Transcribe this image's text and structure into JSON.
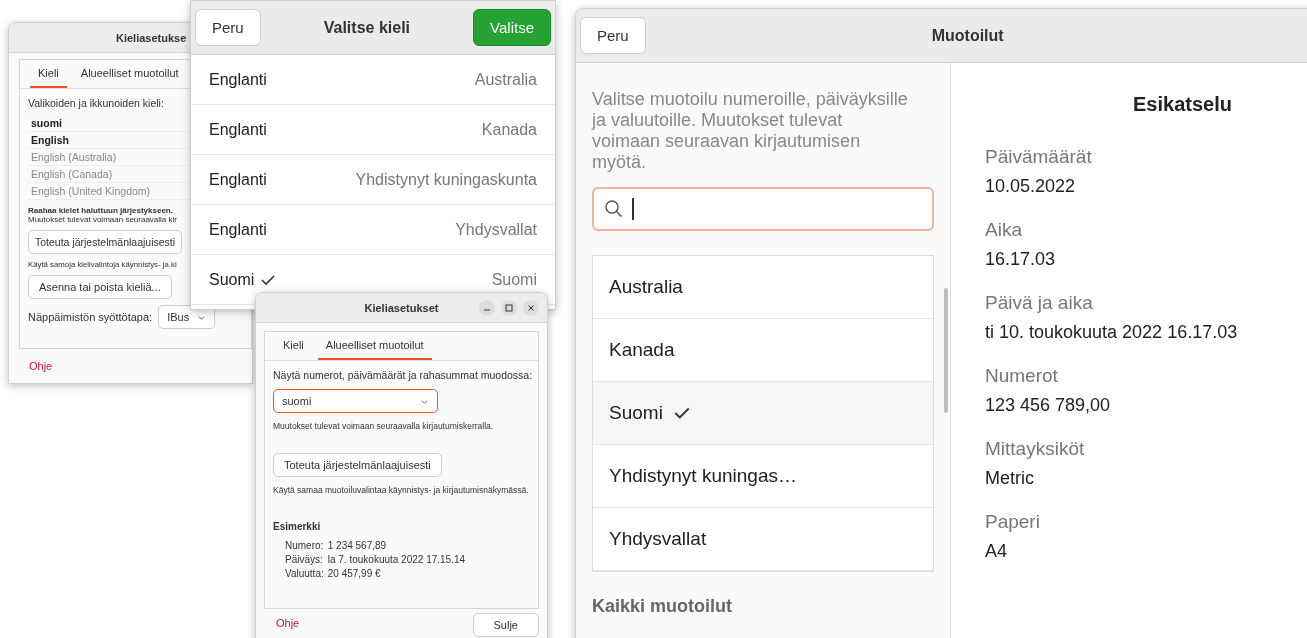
{
  "language_dialog": {
    "title": "Kieliasetukse",
    "tabs": [
      {
        "label": "Kieli",
        "selected": true
      },
      {
        "label": "Alueelliset muotoilut",
        "selected": false
      }
    ],
    "list_label": "Valikoiden ja ikkunoiden kieli:",
    "languages": [
      {
        "label": "suomi",
        "active": true
      },
      {
        "label": "English",
        "active": true
      },
      {
        "label": "English (Australia)",
        "active": false
      },
      {
        "label": "English (Canada)",
        "active": false
      },
      {
        "label": "English (United Kingdom)",
        "active": false
      }
    ],
    "hint_bold": "Raahaa kielet haluttuun järjestykseen.",
    "hint": "Muutokset tulevat voimaan seuraavalla kir",
    "apply_button": "Toteuta järjestelmänlaajuisesti",
    "apply_note": "Käytä samoja kielivalintoja käynnistys- ja ki",
    "install_button": "Asenna tai poista kieliä...",
    "keyboard_label": "Näppäimistön syöttötapa:",
    "keyboard_value": "IBus",
    "help_link": "Ohje"
  },
  "language_picker": {
    "cancel": "Peru",
    "title": "Valitse kieli",
    "confirm": "Valitse",
    "rows": [
      {
        "language": "Englanti",
        "region": "Australia",
        "selected": false
      },
      {
        "language": "Englanti",
        "region": "Kanada",
        "selected": false
      },
      {
        "language": "Englanti",
        "region": "Yhdistynyt kuningaskunta",
        "selected": false
      },
      {
        "language": "Englanti",
        "region": "Yhdysvallat",
        "selected": false
      },
      {
        "language": "Suomi",
        "region": "Suomi",
        "selected": true
      }
    ]
  },
  "format_dialog": {
    "title": "Kieliasetukset",
    "tabs": [
      {
        "label": "Kieli",
        "selected": false
      },
      {
        "label": "Alueelliset muotoilut",
        "selected": true
      }
    ],
    "format_label": "Näytä numerot, päivämäärät ja rahasummat muodossa:",
    "format_value": "suomi",
    "note": "Muutokset tulevat voimaan seuraavalla kirjautumiskerralla.",
    "apply_button": "Toteuta järjestelmänlaajuisesti",
    "apply_note": "Käytä samaa muotoiluvalintaa käynnistys- ja kirjautumisnäkymässä.",
    "example_title": "Esimerkki",
    "examples": [
      {
        "label": "Numero:",
        "value": "1 234 567,89"
      },
      {
        "label": "Päiväys:",
        "value": "la 7. toukokuuta 2022 17.15.14"
      },
      {
        "label": "Valuutta:",
        "value": "20 457,99 €"
      }
    ],
    "help_link": "Ohje",
    "close_button": "Sulje"
  },
  "formats_window": {
    "cancel": "Peru",
    "title": "Muotoilut",
    "description": "Valitse muotoilu numeroille, päiväyksille ja valuutoille. Muutokset tulevat voimaan seuraavan kirjautumisen myötä.",
    "regions": [
      {
        "label": "Australia",
        "selected": false
      },
      {
        "label": "Kanada",
        "selected": false
      },
      {
        "label": "Suomi",
        "selected": true
      },
      {
        "label": "Yhdistynyt kuningas…",
        "selected": false
      },
      {
        "label": "Yhdysvallat",
        "selected": false
      }
    ],
    "all_formats": "Kaikki muotoilut",
    "preview_title": "Esikatselu",
    "preview": [
      {
        "label": "Päivämäärät",
        "value": "10.05.2022"
      },
      {
        "label": "Aika",
        "value": "16.17.03"
      },
      {
        "label": "Päivä ja aika",
        "value": "ti 10. toukokuuta 2022 16.17.03"
      },
      {
        "label": "Numerot",
        "value": "123 456 789,00"
      },
      {
        "label": "Mittayksiköt",
        "value": "Metric"
      },
      {
        "label": "Paperi",
        "value": "A4"
      }
    ]
  }
}
